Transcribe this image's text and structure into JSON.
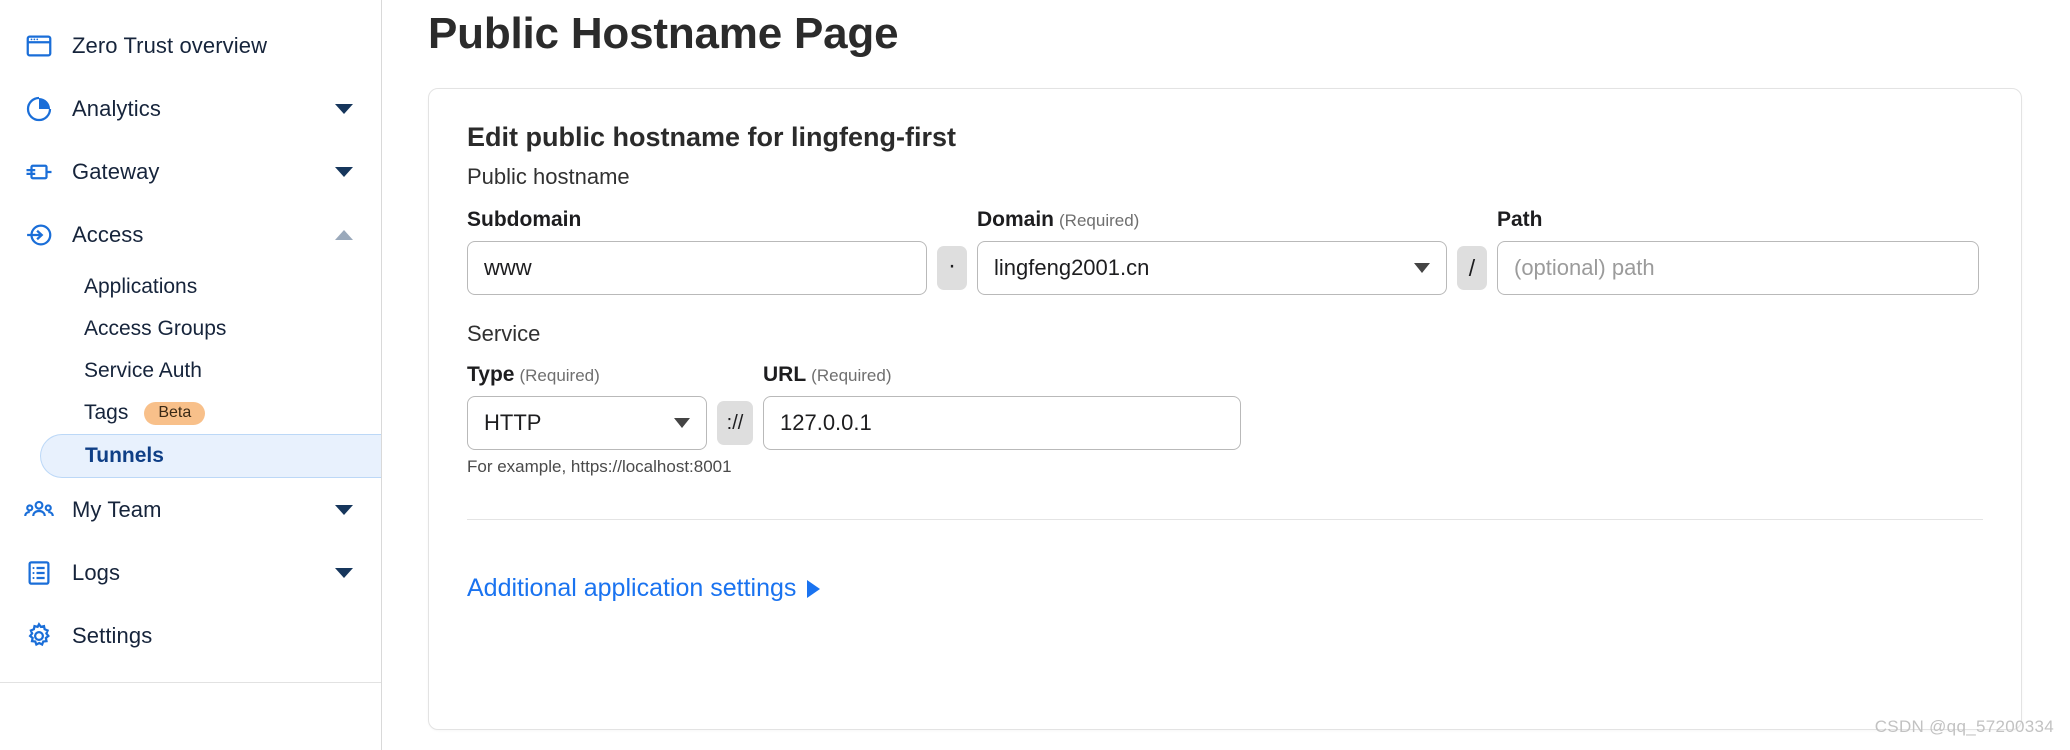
{
  "sidebar": {
    "items": [
      {
        "label": "Zero Trust overview",
        "icon": "window-icon",
        "caret": null
      },
      {
        "label": "Analytics",
        "icon": "pie-chart-icon",
        "caret": "down"
      },
      {
        "label": "Gateway",
        "icon": "gateway-icon",
        "caret": "down"
      },
      {
        "label": "Access",
        "icon": "access-arrow-icon",
        "caret": "up"
      },
      {
        "label": "My Team",
        "icon": "team-icon",
        "caret": "down"
      },
      {
        "label": "Logs",
        "icon": "logs-icon",
        "caret": "down"
      },
      {
        "label": "Settings",
        "icon": "gear-icon",
        "caret": null
      }
    ],
    "access_subitems": [
      {
        "label": "Applications",
        "badge": null,
        "active": false
      },
      {
        "label": "Access Groups",
        "badge": null,
        "active": false
      },
      {
        "label": "Service Auth",
        "badge": null,
        "active": false
      },
      {
        "label": "Tags",
        "badge": "Beta",
        "active": false
      },
      {
        "label": "Tunnels",
        "badge": null,
        "active": true
      }
    ]
  },
  "page": {
    "title": "Public Hostname Page",
    "card_title": "Edit public hostname for lingfeng-first",
    "hostname_section_label": "Public hostname",
    "service_section_label": "Service",
    "hostname": {
      "subdomain_label": "Subdomain",
      "subdomain_value": "www",
      "subdomain_placeholder": "",
      "dot_separator": "·",
      "domain_label": "Domain",
      "domain_required": "(Required)",
      "domain_value": "lingfeng2001.cn",
      "slash_separator": "/",
      "path_label": "Path",
      "path_value": "",
      "path_placeholder": "(optional) path"
    },
    "service": {
      "type_label": "Type",
      "type_required": "(Required)",
      "type_value": "HTTP",
      "protocol_separator": "://",
      "url_label": "URL",
      "url_required": "(Required)",
      "url_value": "127.0.0.1",
      "url_placeholder": "",
      "hint": "For example, https://localhost:8001"
    },
    "additional_settings_link": "Additional application settings"
  },
  "watermark": "CSDN @qq_57200334",
  "colors": {
    "accent_blue": "#1a73f0",
    "nav_icon_blue": "#1a6ed8",
    "active_pill_bg": "#e8f1fd",
    "active_pill_border": "#bcd8f7",
    "active_text": "#0f3f86",
    "beta_badge_bg": "#f8c08a",
    "separator_bg": "#dedede"
  }
}
